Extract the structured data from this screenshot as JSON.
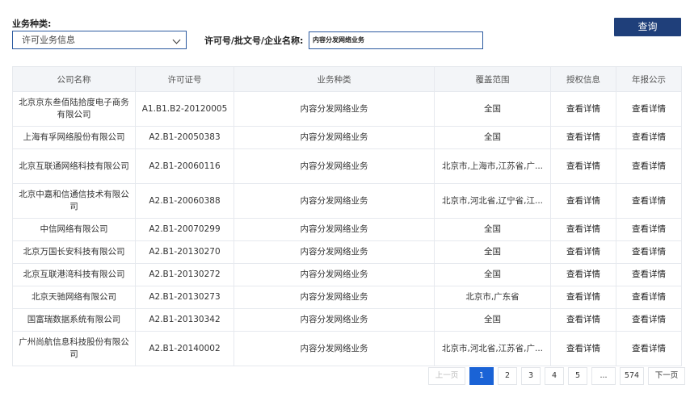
{
  "filters": {
    "business_type_label": "业务种类:",
    "business_type_value": "许可业务信息",
    "license_label": "许可号/批文号/企业名称:",
    "license_value": "内容分发网络业务",
    "query_button": "查询"
  },
  "table": {
    "headers": [
      "公司名称",
      "许可证号",
      "业务种类",
      "覆盖范围",
      "授权信息",
      "年报公示"
    ],
    "rows": [
      {
        "company": "北京京东叁佰陆拾度电子商务有限公司",
        "license": "A1.B1.B2-20120005",
        "type": "内容分发网络业务",
        "coverage": "全国",
        "auth": "查看详情",
        "report": "查看详情"
      },
      {
        "company": "上海有孚网络股份有限公司",
        "license": "A2.B1-20050383",
        "type": "内容分发网络业务",
        "coverage": "全国",
        "auth": "查看详情",
        "report": "查看详情"
      },
      {
        "company": "北京互联通网络科技有限公司",
        "license": "A2.B1-20060116",
        "type": "内容分发网络业务",
        "coverage": "北京市,上海市,江苏省,广...",
        "auth": "查看详情",
        "report": "查看详情"
      },
      {
        "company": "北京中嘉和信通信技术有限公司",
        "license": "A2.B1-20060388",
        "type": "内容分发网络业务",
        "coverage": "北京市,河北省,辽宁省,江...",
        "auth": "查看详情",
        "report": "查看详情"
      },
      {
        "company": "中信网络有限公司",
        "license": "A2.B1-20070299",
        "type": "内容分发网络业务",
        "coverage": "全国",
        "auth": "查看详情",
        "report": "查看详情"
      },
      {
        "company": "北京万国长安科技有限公司",
        "license": "A2.B1-20130270",
        "type": "内容分发网络业务",
        "coverage": "全国",
        "auth": "查看详情",
        "report": "查看详情"
      },
      {
        "company": "北京互联港湾科技有限公司",
        "license": "A2.B1-20130272",
        "type": "内容分发网络业务",
        "coverage": "全国",
        "auth": "查看详情",
        "report": "查看详情"
      },
      {
        "company": "北京天驰网络有限公司",
        "license": "A2.B1-20130273",
        "type": "内容分发网络业务",
        "coverage": "北京市,广东省",
        "auth": "查看详情",
        "report": "查看详情"
      },
      {
        "company": "国富瑞数据系统有限公司",
        "license": "A2.B1-20130342",
        "type": "内容分发网络业务",
        "coverage": "全国",
        "auth": "查看详情",
        "report": "查看详情"
      },
      {
        "company": "广州尚航信息科技股份有限公司",
        "license": "A2.B1-20140002",
        "type": "内容分发网络业务",
        "coverage": "北京市,河北省,江苏省,广...",
        "auth": "查看详情",
        "report": "查看详情"
      }
    ]
  },
  "pagination": {
    "prev": "上一页",
    "pages": [
      "1",
      "2",
      "3",
      "4",
      "5",
      "...",
      "574"
    ],
    "current": "1",
    "next": "下一页"
  }
}
